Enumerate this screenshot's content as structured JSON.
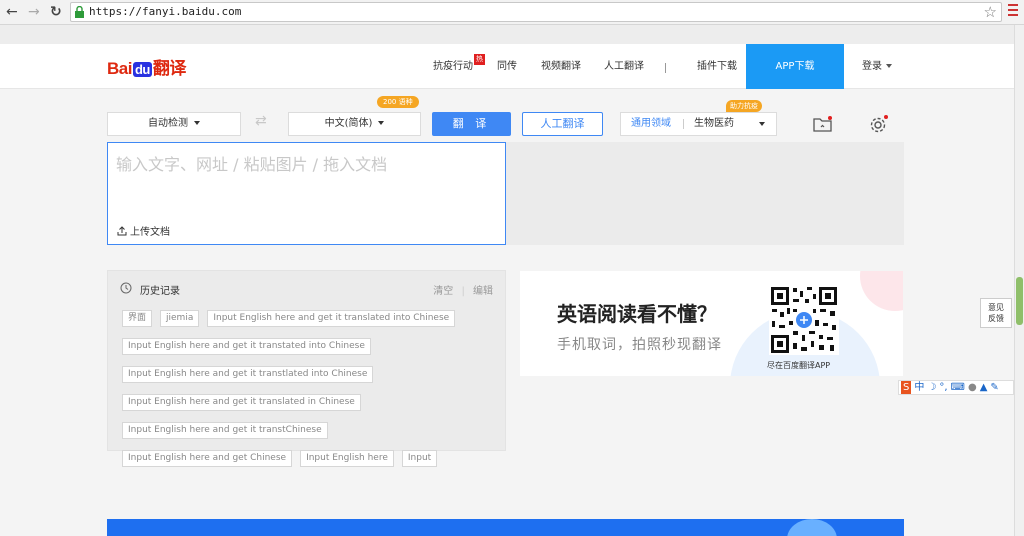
{
  "browser": {
    "back": "←",
    "forward": "→",
    "reload": "↻",
    "url": "https://fanyi.baidu.com",
    "bookmark_icon": "star-icon",
    "menu_icon": "hamburger-menu-icon"
  },
  "header": {
    "logo_text_1": "Bai",
    "logo_text_du": "du",
    "logo_text_2": "翻译",
    "nav": [
      "抗疫行动",
      "同传",
      "视频翻译",
      "人工翻译",
      "插件下载"
    ],
    "hot_badge": "热",
    "app_download": "APP下载",
    "login": "登录"
  },
  "toolbar": {
    "source_lang": "自动检测",
    "swap_icon": "⇄",
    "target_lang": "中文(简体)",
    "lang_count_badge": "200 语种",
    "translate_button": "翻 译",
    "human_translate_button": "人工翻译",
    "domain_general": "通用领域",
    "domain_selected": "生物医药",
    "domain_badge": "助力抗疫",
    "colors": {
      "accent": "#3f88f4",
      "badge": "#f5a623"
    }
  },
  "input": {
    "placeholder": "输入文字、网址 / 粘贴图片 / 拖入文档",
    "upload": "上传文档"
  },
  "history": {
    "title": "历史记录",
    "clear": "清空",
    "edit": "编辑",
    "items": [
      "界面",
      "jiemia",
      "Input English here and get it translated into Chinese",
      "Input English here and get it transtated into Chinese",
      "Input English here and get it transtlated into Chinese",
      "Input English here and get it translated in Chinese",
      "Input English here and get it transtChinese",
      "Input English here and get Chinese",
      "Input English here",
      "Input"
    ]
  },
  "ad": {
    "title": "英语阅读看不懂？",
    "subtitle": "手机取词，拍照秒现翻译",
    "qr_caption": "尽在百度翻译APP"
  },
  "feedback": {
    "line1": "意见",
    "line2": "反馈"
  },
  "ime": {
    "logo": "S",
    "mode": "中"
  }
}
